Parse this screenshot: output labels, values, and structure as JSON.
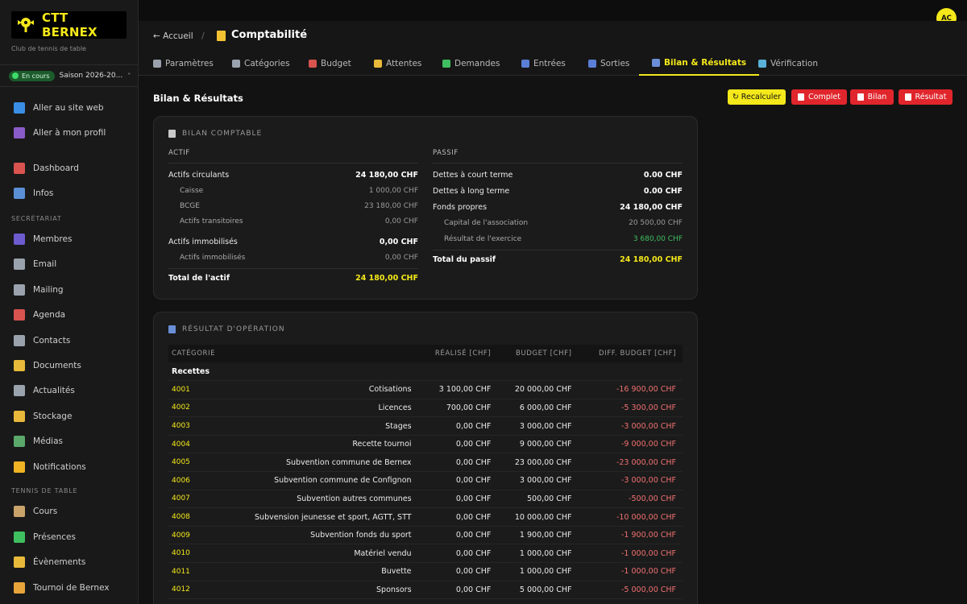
{
  "brand": {
    "name": "CTT BERNEX",
    "subtitle": "Club de tennis de table"
  },
  "season": {
    "status": "En cours",
    "label": "Saison 2026-20...",
    "chevron": "˅"
  },
  "sidebar": {
    "items_top": [
      {
        "label": "Aller au site web",
        "icon": "globe-icon",
        "color": "#3a8ee6"
      },
      {
        "label": "Aller à mon profil",
        "icon": "person-icon",
        "color": "#8a5cc7"
      }
    ],
    "items_main": [
      {
        "label": "Dashboard",
        "icon": "dashboard-icon",
        "color": "#d9534f"
      },
      {
        "label": "Infos",
        "icon": "building-icon",
        "color": "#5b8fd6"
      }
    ],
    "section_secretariat": "SECRÉTARIAT",
    "items_secretariat": [
      {
        "label": "Membres",
        "icon": "members-icon",
        "color": "#6d5bd0"
      },
      {
        "label": "Email",
        "icon": "email-icon",
        "color": "#9aa3ad"
      },
      {
        "label": "Mailing",
        "icon": "mailing-icon",
        "color": "#9aa3ad"
      },
      {
        "label": "Agenda",
        "icon": "calendar-icon",
        "color": "#d9534f"
      },
      {
        "label": "Contacts",
        "icon": "contacts-icon",
        "color": "#9aa3ad"
      },
      {
        "label": "Documents",
        "icon": "folder-icon",
        "color": "#e8b93a"
      },
      {
        "label": "Actualités",
        "icon": "news-icon",
        "color": "#9aa3ad"
      },
      {
        "label": "Stockage",
        "icon": "storage-icon",
        "color": "#e8b93a"
      },
      {
        "label": "Médias",
        "icon": "media-icon",
        "color": "#5aa86a"
      },
      {
        "label": "Notifications",
        "icon": "bell-icon",
        "color": "#f0b323"
      }
    ],
    "section_tennis": "TENNIS DE TABLE",
    "items_tennis": [
      {
        "label": "Cours",
        "icon": "clipboard-icon",
        "color": "#c9a36a"
      },
      {
        "label": "Présences",
        "icon": "check-icon",
        "color": "#3fbf5f"
      },
      {
        "label": "Évènements",
        "icon": "trophy-icon",
        "color": "#e8b93a"
      },
      {
        "label": "Tournoi de Bernex",
        "icon": "medal-icon",
        "color": "#e8a53a"
      }
    ]
  },
  "user": {
    "initials": "AC"
  },
  "header": {
    "back": "← Accueil",
    "separator": "/",
    "title": "Comptabilité"
  },
  "tabs": [
    {
      "label": "Paramètres",
      "icon": "gear-icon",
      "color": "#9aa3ad"
    },
    {
      "label": "Catégories",
      "icon": "tags-icon",
      "color": "#9aa3ad"
    },
    {
      "label": "Budget",
      "icon": "chart-icon",
      "color": "#d9534f"
    },
    {
      "label": "Attentes",
      "icon": "hourglass-icon",
      "color": "#e8b93a"
    },
    {
      "label": "Demandes",
      "icon": "check-icon",
      "color": "#3fbf5f"
    },
    {
      "label": "Entrées",
      "icon": "inbox-icon",
      "color": "#5b7fd6"
    },
    {
      "label": "Sorties",
      "icon": "outbox-icon",
      "color": "#5b7fd6"
    },
    {
      "label": "Bilan & Résultats",
      "icon": "chart-icon",
      "color": "#6a8fd6",
      "active": true
    },
    {
      "label": "Vérification",
      "icon": "search-icon",
      "color": "#5ab0d6"
    }
  ],
  "page": {
    "title": "Bilan & Résultats",
    "buttons": {
      "recalc": "↻ Recalculer",
      "complet": "Complet",
      "bilan": "Bilan",
      "resultat": "Résultat"
    }
  },
  "bilan": {
    "title": "BILAN COMPTABLE",
    "actif_head": "ACTIF",
    "passif_head": "PASSIF",
    "actif": [
      {
        "label": "Actifs circulants",
        "value": "24 180,00 CHF",
        "kind": "main"
      },
      {
        "label": "Caisse",
        "value": "1 000,00 CHF",
        "kind": "sub"
      },
      {
        "label": "BCGE",
        "value": "23 180,00 CHF",
        "kind": "sub"
      },
      {
        "label": "Actifs transitoires",
        "value": "0,00 CHF",
        "kind": "sub"
      },
      {
        "label": "Actifs immobilisés",
        "value": "0,00 CHF",
        "kind": "main"
      },
      {
        "label": "Actifs immobilisés",
        "value": "0,00 CHF",
        "kind": "sub"
      }
    ],
    "actif_total": {
      "label": "Total de l'actif",
      "value": "24 180,00 CHF"
    },
    "passif": [
      {
        "label": "Dettes à court terme",
        "value": "0.00 CHF",
        "kind": "main"
      },
      {
        "label": "Dettes à long terme",
        "value": "0.00 CHF",
        "kind": "main"
      },
      {
        "label": "Fonds propres",
        "value": "24 180,00 CHF",
        "kind": "main"
      },
      {
        "label": "Capital de l'association",
        "value": "20 500,00 CHF",
        "kind": "sub"
      },
      {
        "label": "Résultat de l'exercice",
        "value": "3 680,00 CHF",
        "kind": "sub",
        "positive": true
      }
    ],
    "passif_total": {
      "label": "Total du passif",
      "value": "24 180,00 CHF"
    }
  },
  "resultat": {
    "title": "RÉSULTAT D'OPÉRATION",
    "columns": [
      "CATÉGORIE",
      "RÉALISÉ [CHF]",
      "BUDGET [CHF]",
      "DIFF. BUDGET [CHF]"
    ],
    "group": "Recettes",
    "rows": [
      {
        "code": "4001",
        "name": "Cotisations",
        "realise": "3 100,00 CHF",
        "budget": "20 000,00 CHF",
        "diff": "-16 900,00 CHF"
      },
      {
        "code": "4002",
        "name": "Licences",
        "realise": "700,00 CHF",
        "budget": "6 000,00 CHF",
        "diff": "-5 300,00 CHF"
      },
      {
        "code": "4003",
        "name": "Stages",
        "realise": "0,00 CHF",
        "budget": "3 000,00 CHF",
        "diff": "-3 000,00 CHF"
      },
      {
        "code": "4004",
        "name": "Recette tournoi",
        "realise": "0,00 CHF",
        "budget": "9 000,00 CHF",
        "diff": "-9 000,00 CHF"
      },
      {
        "code": "4005",
        "name": "Subvention commune de Bernex",
        "realise": "0,00 CHF",
        "budget": "23 000,00 CHF",
        "diff": "-23 000,00 CHF"
      },
      {
        "code": "4006",
        "name": "Subvention commune de Confignon",
        "realise": "0,00 CHF",
        "budget": "3 000,00 CHF",
        "diff": "-3 000,00 CHF"
      },
      {
        "code": "4007",
        "name": "Subvention autres communes",
        "realise": "0,00 CHF",
        "budget": "500,00 CHF",
        "diff": "-500,00 CHF"
      },
      {
        "code": "4008",
        "name": "Subvension jeunesse et sport, AGTT, STT",
        "realise": "0,00 CHF",
        "budget": "10 000,00 CHF",
        "diff": "-10 000,00 CHF"
      },
      {
        "code": "4009",
        "name": "Subvention fonds du sport",
        "realise": "0,00 CHF",
        "budget": "1 900,00 CHF",
        "diff": "-1 900,00 CHF"
      },
      {
        "code": "4010",
        "name": "Matériel vendu",
        "realise": "0,00 CHF",
        "budget": "1 000,00 CHF",
        "diff": "-1 000,00 CHF"
      },
      {
        "code": "4011",
        "name": "Buvette",
        "realise": "0,00 CHF",
        "budget": "1 000,00 CHF",
        "diff": "-1 000,00 CHF"
      },
      {
        "code": "4012",
        "name": "Sponsors",
        "realise": "0,00 CHF",
        "budget": "5 000,00 CHF",
        "diff": "-5 000,00 CHF"
      }
    ]
  },
  "colors": {
    "accent": "#f4e81a",
    "danger": "#e0262c",
    "positive": "#3fbf5f",
    "negative": "#f07070"
  }
}
